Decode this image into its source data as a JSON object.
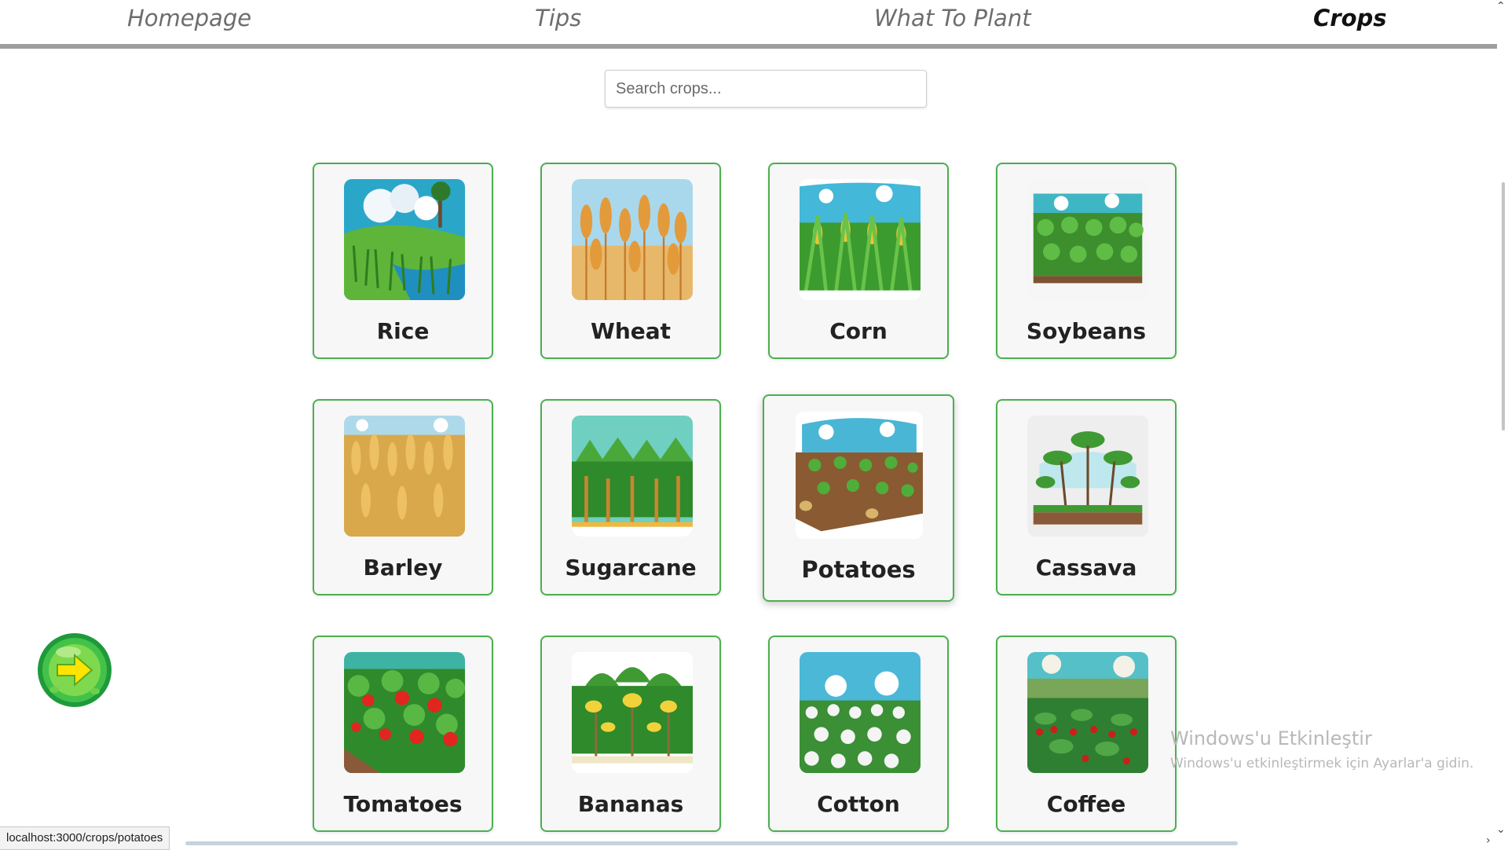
{
  "nav": {
    "items": [
      {
        "label": "Homepage"
      },
      {
        "label": "Tips"
      },
      {
        "label": "What To Plant"
      },
      {
        "label": "Crops",
        "active": true
      }
    ]
  },
  "search": {
    "placeholder": "Search crops...",
    "value": ""
  },
  "crops": [
    {
      "name": "Rice",
      "icon": "rice-field-image"
    },
    {
      "name": "Wheat",
      "icon": "wheat-field-image"
    },
    {
      "name": "Corn",
      "icon": "corn-field-image"
    },
    {
      "name": "Soybeans",
      "icon": "soybean-field-image"
    },
    {
      "name": "Barley",
      "icon": "barley-field-image"
    },
    {
      "name": "Sugarcane",
      "icon": "sugarcane-field-image"
    },
    {
      "name": "Potatoes",
      "icon": "potato-field-image"
    },
    {
      "name": "Cassava",
      "icon": "cassava-plant-image"
    },
    {
      "name": "Tomatoes",
      "icon": "tomato-plants-image"
    },
    {
      "name": "Bananas",
      "icon": "banana-trees-image"
    },
    {
      "name": "Cotton",
      "icon": "cotton-field-image"
    },
    {
      "name": "Coffee",
      "icon": "coffee-plants-image"
    }
  ],
  "fab": {
    "icon": "green-right-arrow-icon"
  },
  "watermark": {
    "title": "Windows'u Etkinleştir",
    "subtitle": "Windows'u etkinleştirmek için Ayarlar'a gidin."
  },
  "status": {
    "url": "localhost:3000/crops/potatoes"
  },
  "colors": {
    "card_border": "#4caf50",
    "nav_rule": "#9e9e9e",
    "card_bg": "#f7f7f7"
  }
}
